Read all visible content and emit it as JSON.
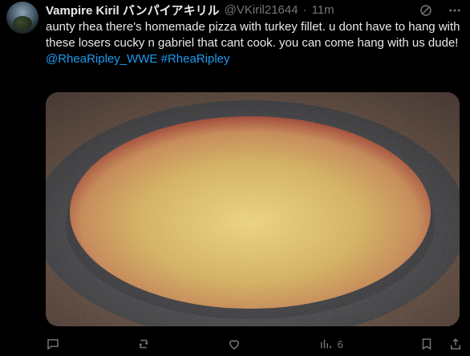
{
  "tweet": {
    "author": {
      "name": "Vampire Kiril バンパイアキリル",
      "handle": "@VKiril21644",
      "separator": "·",
      "time": "11m"
    },
    "text": "aunty rhea there's homemade pizza with turkey fillet. u dont have to hang with these losers cucky n gabriel that cant cook. you can come hang with us dude!",
    "hashtags": [
      "@RheaRipley_WWE",
      "#RheaRipley"
    ],
    "image": {
      "description_icon": "photo",
      "subject": "homemade-pizza-with-turkey-fillet"
    }
  },
  "actions": {
    "views": "6"
  }
}
